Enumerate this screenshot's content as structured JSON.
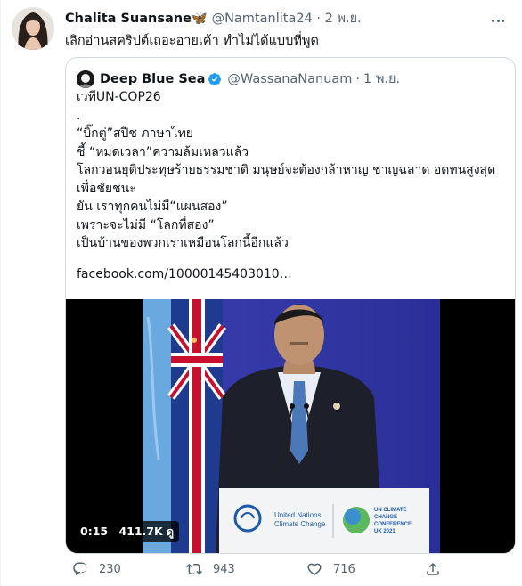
{
  "tweet": {
    "author_name": "Chalita Suansane",
    "author_emoji": "🦋",
    "handle": "@Namtanlita24",
    "separator": "·",
    "time": "2 พ.ย.",
    "text": "เลิกอ่านสคริปต์เถอะอายเค้า ทำไม่ได้แบบที่พูด"
  },
  "quote": {
    "author_name": "Deep Blue Sea",
    "handle": "@WassanaNanuam",
    "separator": "·",
    "time": "1 พ.ย.",
    "lines": [
      "เวทีUN-COP26",
      ".",
      "“บิ๊กตู่”สปีช ภาษาไทย",
      "ชี้ “หมดเวลา”ความล้มเหลวแล้ว",
      "โลกวอนยุติประทุษร้ายธรรมชาติ มนุษย์จะต้องกล้าหาญ ชาญฉลาด อดทนสูงสุด",
      "เพื่อชัยชนะ",
      "ยัน เราทุกคนไม่มี“แผนสอง”",
      "เพราะจะไม่มี “โลกที่สอง”",
      "เป็นบ้านของพวกเราเหมือนโลกนี้อีกแล้ว"
    ],
    "link": "facebook.com/10000145403010…",
    "video": {
      "duration": "0:15",
      "views": "411.7K ดู",
      "podium_org": "United Nations",
      "podium_org2": "Climate Change",
      "podium_conf": "UN CLIMATE CHANGE CONFERENCE UK 2021"
    }
  },
  "actions": {
    "replies": "230",
    "retweets": "943",
    "likes": "716"
  },
  "colors": {
    "text": "#0f1419",
    "muted": "#536471",
    "verified": "#1d9bf0",
    "border": "#cfd9de"
  }
}
